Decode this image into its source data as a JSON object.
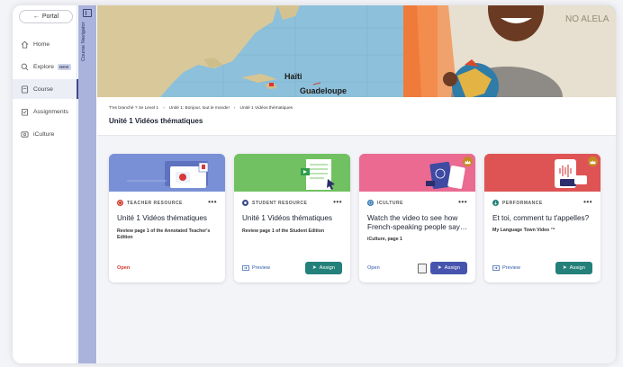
{
  "sidebar": {
    "portal_label": "Portal",
    "items": [
      {
        "label": "Home"
      },
      {
        "label": "Explore",
        "badge": "NEW"
      },
      {
        "label": "Course"
      },
      {
        "label": "Assignments"
      },
      {
        "label": "iCulture"
      }
    ]
  },
  "navigator": {
    "label": "Course Navigator"
  },
  "banner": {
    "labels": [
      "Haïti",
      "Guadeloupe"
    ],
    "wall_text": "NO ALELA"
  },
  "header": {
    "breadcrumb": [
      "T'es branché ? 3e Level 1",
      "Unité 1: Bonjour, tout le monde!",
      "Unité 1 Vidéos thématiques"
    ],
    "title": "Unité 1 Vidéos thématiques"
  },
  "cards": [
    {
      "kind": "TEACHER RESOURCE",
      "title": "Unité 1 Vidéos thématiques",
      "subtitle": "Review page 1 of the Annotated Teacher's Edition",
      "open_label": "Open",
      "accent": "#6f86cf"
    },
    {
      "kind": "STUDENT RESOURCE",
      "title": "Unité 1 Vidéos thématiques",
      "subtitle": "Review page 1 of the Student Edition",
      "preview_label": "Preview",
      "assign_label": "Assign",
      "accent": "#6bbb5e"
    },
    {
      "kind": "ICULTURE",
      "title": "Watch the video to see how French-speaking people say…",
      "subtitle": "iCulture, page 1",
      "open_label": "Open",
      "assign_label": "Assign",
      "accent": "#e75a86"
    },
    {
      "kind": "PERFORMANCE",
      "title": "Et toi, comment tu t'appelles?",
      "subtitle": "My Language Town Video ™",
      "preview_label": "Preview",
      "assign_label": "Assign",
      "accent": "#d94b4b"
    }
  ]
}
